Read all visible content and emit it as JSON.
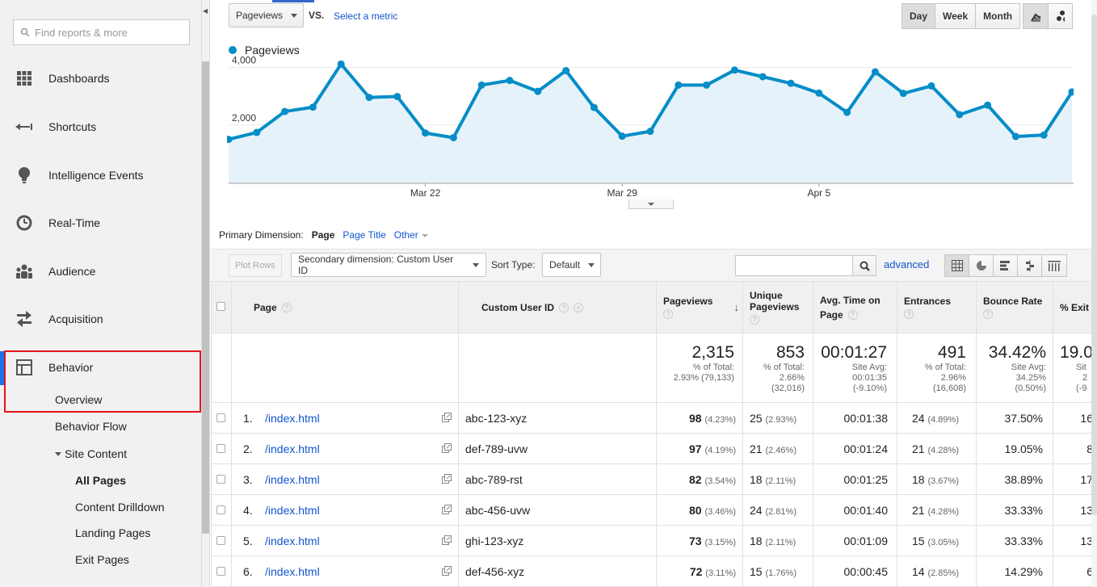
{
  "sidebar": {
    "search_placeholder": "Find reports & more",
    "items": [
      {
        "label": "Dashboards",
        "icon": "grid-icon"
      },
      {
        "label": "Shortcuts",
        "icon": "shortcut-arrow-icon"
      },
      {
        "label": "Intelligence Events",
        "icon": "lightbulb-icon"
      },
      {
        "label": "Real-Time",
        "icon": "clock-icon"
      },
      {
        "label": "Audience",
        "icon": "people-icon"
      },
      {
        "label": "Acquisition",
        "icon": "acquisition-arrows-icon"
      },
      {
        "label": "Behavior",
        "icon": "behavior-layout-icon"
      }
    ],
    "behavior_sub": {
      "overview": "Overview",
      "flow": "Behavior Flow",
      "site_content": "Site Content",
      "all_pages": "All Pages",
      "content_drilldown": "Content Drilldown",
      "landing_pages": "Landing Pages",
      "exit_pages": "Exit Pages"
    },
    "accent_color": "#1a73e8",
    "highlight_color": "#e4141c"
  },
  "controls": {
    "metric": "Pageviews",
    "vs": "VS.",
    "select_metric": "Select a metric",
    "day": "Day",
    "week": "Week",
    "month": "Month",
    "selected_period": "Day"
  },
  "chart_data": {
    "type": "area",
    "title": "",
    "series": [
      {
        "name": "Pageviews",
        "color": "#058dc7",
        "values": [
          1500,
          1740,
          2470,
          2620,
          4120,
          2960,
          2990,
          1720,
          1560,
          3390,
          3550,
          3170,
          3890,
          2610,
          1610,
          1780,
          3390,
          3390,
          3910,
          3680,
          3450,
          3110,
          2440,
          3850,
          3100,
          3360,
          2360,
          2690,
          1600,
          1650,
          3150
        ]
      }
    ],
    "x_tick_labels": [
      "Mar 22",
      "Mar 29",
      "Apr 5"
    ],
    "y_tick_labels": [
      "4,000",
      "2,000"
    ],
    "ylim": [
      0,
      5000
    ],
    "grid": true,
    "legend": "top-left"
  },
  "dimension": {
    "label": "Primary Dimension:",
    "page": "Page",
    "page_title": "Page Title",
    "other": "Other"
  },
  "toolbar": {
    "plot_rows": "Plot Rows",
    "secondary": "Secondary dimension: Custom User ID",
    "sort_type_label": "Sort Type:",
    "sort_type": "Default",
    "advanced": "advanced"
  },
  "table": {
    "headers": {
      "page": "Page",
      "user": "Custom User ID",
      "pageviews": "Pageviews",
      "unique": "Unique Pageviews",
      "avg_time": "Avg. Time on Page",
      "entrances": "Entrances",
      "bounce": "Bounce Rate",
      "exit": "% Exit"
    },
    "totals": {
      "pageviews": {
        "value": "2,315",
        "sub1": "% of Total:",
        "sub2": "2.93% (79,133)"
      },
      "unique": {
        "value": "853",
        "sub1": "% of Total:",
        "sub2": "2.66%",
        "sub3": "(32,016)"
      },
      "avg_time": {
        "value": "00:01:27",
        "sub1": "Site Avg:",
        "sub2": "00:01:35",
        "sub3": "(-9.10%)"
      },
      "entrances": {
        "value": "491",
        "sub1": "% of Total:",
        "sub2": "2.96%",
        "sub3": "(16,608)"
      },
      "bounce": {
        "value": "34.42%",
        "sub1": "Site Avg:",
        "sub2": "34.25%",
        "sub3": "(0.50%)"
      },
      "exit": {
        "value": "19.0",
        "sub1": "Sit",
        "sub2": "2",
        "sub3": "(-9"
      }
    },
    "rows": [
      {
        "idx": "1.",
        "page": "/index.html",
        "user": "abc-123-xyz",
        "pv": "98",
        "pv_pct": "(4.23%)",
        "uq": "25",
        "uq_pct": "(2.93%)",
        "time": "00:01:38",
        "ent": "24",
        "ent_pct": "(4.89%)",
        "bounce": "37.50%",
        "exit": "16"
      },
      {
        "idx": "2.",
        "page": "/index.html",
        "user": "def-789-uvw",
        "pv": "97",
        "pv_pct": "(4.19%)",
        "uq": "21",
        "uq_pct": "(2.46%)",
        "time": "00:01:24",
        "ent": "21",
        "ent_pct": "(4.28%)",
        "bounce": "19.05%",
        "exit": "8"
      },
      {
        "idx": "3.",
        "page": "/index.html",
        "user": "abc-789-rst",
        "pv": "82",
        "pv_pct": "(3.54%)",
        "uq": "18",
        "uq_pct": "(2.11%)",
        "time": "00:01:25",
        "ent": "18",
        "ent_pct": "(3.67%)",
        "bounce": "38.89%",
        "exit": "17"
      },
      {
        "idx": "4.",
        "page": "/index.html",
        "user": "abc-456-uvw",
        "pv": "80",
        "pv_pct": "(3.46%)",
        "uq": "24",
        "uq_pct": "(2.81%)",
        "time": "00:01:40",
        "ent": "21",
        "ent_pct": "(4.28%)",
        "bounce": "33.33%",
        "exit": "13"
      },
      {
        "idx": "5.",
        "page": "/index.html",
        "user": "ghi-123-xyz",
        "pv": "73",
        "pv_pct": "(3.15%)",
        "uq": "18",
        "uq_pct": "(2.11%)",
        "time": "00:01:09",
        "ent": "15",
        "ent_pct": "(3.05%)",
        "bounce": "33.33%",
        "exit": "13"
      },
      {
        "idx": "6.",
        "page": "/index.html",
        "user": "def-456-xyz",
        "pv": "72",
        "pv_pct": "(3.11%)",
        "uq": "15",
        "uq_pct": "(1.76%)",
        "time": "00:00:45",
        "ent": "14",
        "ent_pct": "(2.85%)",
        "bounce": "14.29%",
        "exit": "6"
      }
    ]
  }
}
